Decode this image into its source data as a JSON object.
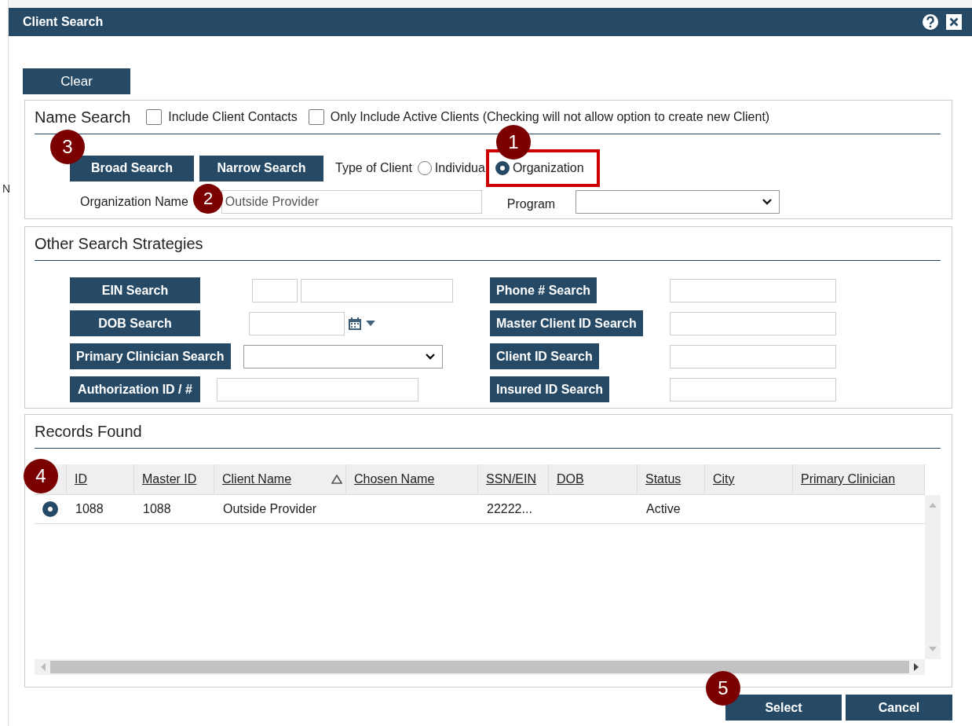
{
  "background": {
    "text": "N"
  },
  "window": {
    "title": "Client Search"
  },
  "clear_button": "Clear",
  "name_search": {
    "title": "Name Search",
    "checkboxes": [
      {
        "label": "Include Client Contacts",
        "checked": false
      },
      {
        "label": "Only Include Active Clients (Checking will not allow option to create new Client)",
        "checked": false
      }
    ],
    "buttons": [
      "Broad Search",
      "Narrow Search"
    ],
    "type_label": "Type of Client",
    "client_types": [
      {
        "label": "Individua",
        "selected": false,
        "highlighted": false
      },
      {
        "label": "Organization",
        "selected": true,
        "highlighted": true
      }
    ],
    "name_field": {
      "label": "Organization Name",
      "value": "Outside Provider"
    },
    "program": {
      "label": "Program"
    }
  },
  "strategies": {
    "title": "Other Search Strategies",
    "items": [
      {
        "label": "EIN Search",
        "kind": "split"
      },
      {
        "label": "Phone # Search",
        "kind": "text"
      },
      {
        "label": "DOB Search",
        "kind": "date"
      },
      {
        "label": "Master Client ID Search",
        "kind": "text"
      },
      {
        "label": "Primary Clinician Search",
        "kind": "select"
      },
      {
        "label": "Client ID Search",
        "kind": "text"
      },
      {
        "label": "Authorization ID / #",
        "kind": "text"
      },
      {
        "label": "Insured ID Search",
        "kind": "text"
      }
    ]
  },
  "records": {
    "title": "Records Found",
    "columns": [
      {
        "label": "ID",
        "sorted": false
      },
      {
        "label": "Master ID",
        "sorted": false
      },
      {
        "label": "Client Name",
        "sorted": true
      },
      {
        "label": "Chosen Name",
        "sorted": false
      },
      {
        "label": "SSN/EIN",
        "sorted": false
      },
      {
        "label": "DOB",
        "sorted": false
      },
      {
        "label": "Status",
        "sorted": false
      },
      {
        "label": "City",
        "sorted": false
      },
      {
        "label": "Primary Clinician",
        "sorted": false
      }
    ],
    "rows": [
      {
        "selected": true,
        "cells": [
          "1088",
          "1088",
          "Outside Provider",
          null,
          "22222...",
          null,
          "Active",
          null,
          null
        ]
      }
    ]
  },
  "footer_buttons": [
    "Select",
    "Cancel"
  ],
  "callouts": [
    "1",
    "2",
    "3",
    "4",
    "5"
  ]
}
